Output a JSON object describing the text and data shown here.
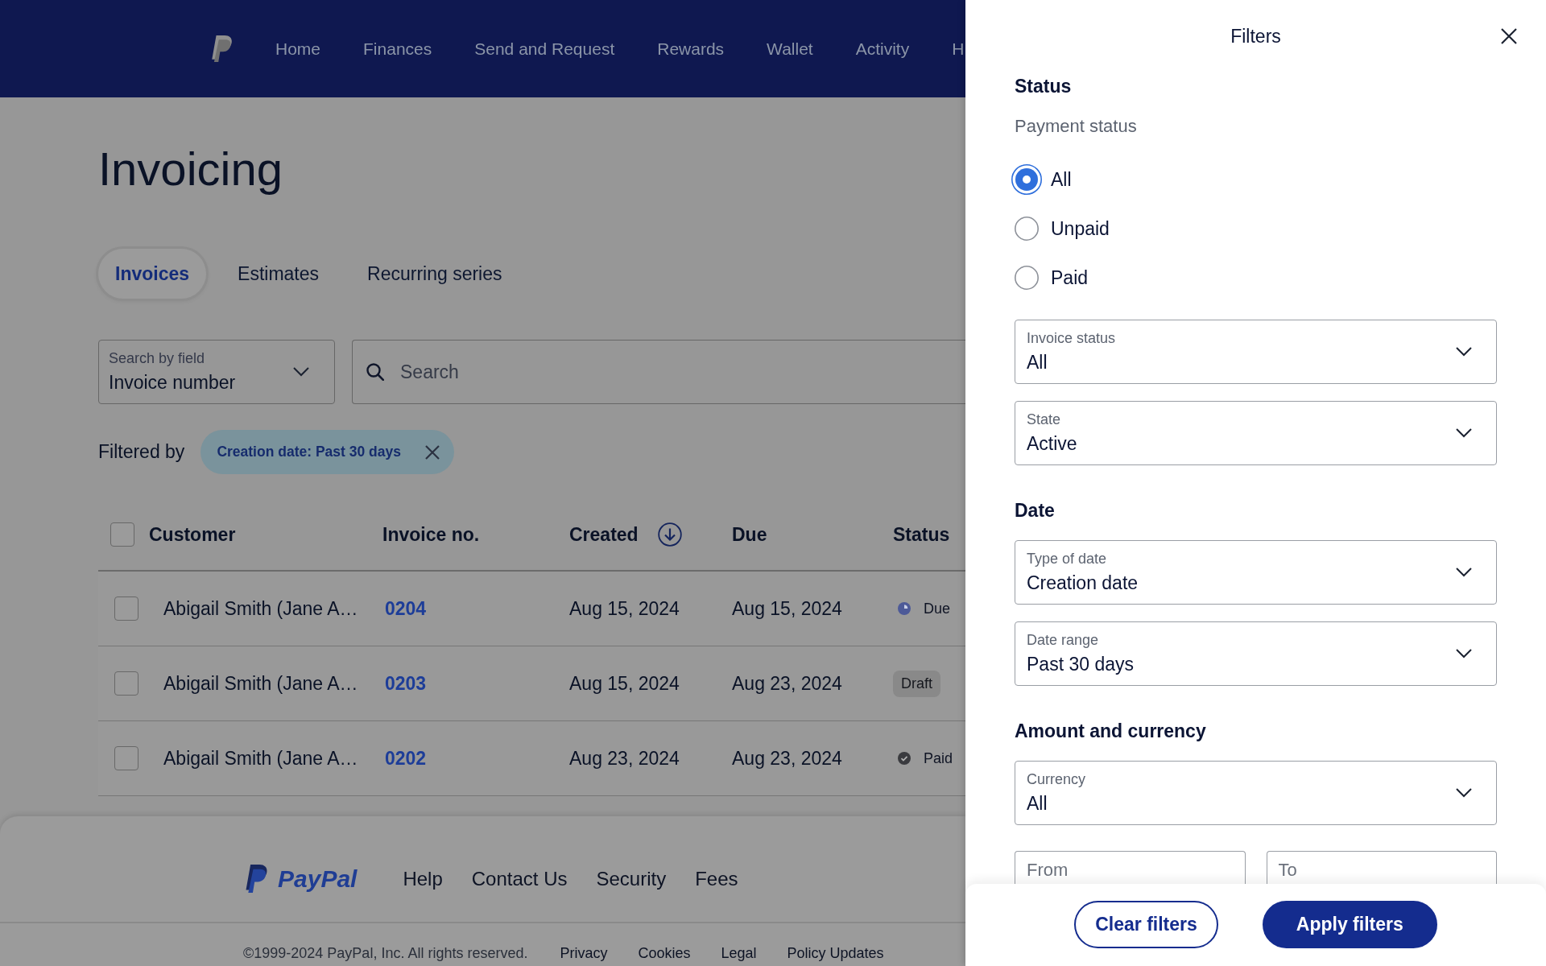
{
  "nav": {
    "items": [
      {
        "label": "Home"
      },
      {
        "label": "Finances"
      },
      {
        "label": "Send and Request"
      },
      {
        "label": "Rewards"
      },
      {
        "label": "Wallet"
      },
      {
        "label": "Activity"
      },
      {
        "label": "H"
      }
    ]
  },
  "page": {
    "title": "Invoicing"
  },
  "tabs": [
    {
      "label": "Invoices",
      "selected": true
    },
    {
      "label": "Estimates",
      "selected": false
    },
    {
      "label": "Recurring series",
      "selected": false
    }
  ],
  "search_by_field": {
    "label": "Search by field",
    "value": "Invoice number"
  },
  "search": {
    "placeholder": "Search"
  },
  "filtered_by": {
    "label": "Filtered by",
    "chips": [
      {
        "label": "Creation date: Past 30 days"
      }
    ]
  },
  "table": {
    "select_all": {
      "checked": false
    },
    "columns": [
      {
        "label": "Customer",
        "sorted": false
      },
      {
        "label": "Invoice no.",
        "sorted": false
      },
      {
        "label": "Created",
        "sorted": true
      },
      {
        "label": "Due",
        "sorted": false
      },
      {
        "label": "Status",
        "sorted": false
      }
    ],
    "rows": [
      {
        "checked": false,
        "customer": "Abigail Smith (Jane A…",
        "invoice_no": "0204",
        "created": "Aug 15, 2024",
        "due": "Aug 15, 2024",
        "status": {
          "kind": "due",
          "label": "Due"
        }
      },
      {
        "checked": false,
        "customer": "Abigail Smith (Jane A…",
        "invoice_no": "0203",
        "created": "Aug 15, 2024",
        "due": "Aug 23, 2024",
        "status": {
          "kind": "draft",
          "label": "Draft"
        }
      },
      {
        "checked": false,
        "customer": "Abigail Smith (Jane A…",
        "invoice_no": "0202",
        "created": "Aug 23, 2024",
        "due": "Aug 23, 2024",
        "status": {
          "kind": "paid",
          "label": "Paid"
        }
      }
    ]
  },
  "footer": {
    "brand": "PayPal",
    "links": [
      "Help",
      "Contact Us",
      "Security",
      "Fees"
    ],
    "copyright": "©1999-2024 PayPal, Inc. All rights reserved.",
    "legal_links": [
      "Privacy",
      "Cookies",
      "Legal",
      "Policy Updates"
    ]
  },
  "filters_panel": {
    "title": "Filters",
    "sections": [
      {
        "heading": "Status",
        "groups": [
          {
            "kind": "radio",
            "label": "Payment status",
            "options": [
              {
                "label": "All",
                "selected": true
              },
              {
                "label": "Unpaid",
                "selected": false
              },
              {
                "label": "Paid",
                "selected": false
              }
            ]
          },
          {
            "kind": "select",
            "label": "Invoice status",
            "value": "All"
          },
          {
            "kind": "select",
            "label": "State",
            "value": "Active"
          }
        ]
      },
      {
        "heading": "Date",
        "groups": [
          {
            "kind": "select",
            "label": "Type of date",
            "value": "Creation date"
          },
          {
            "kind": "select",
            "label": "Date range",
            "value": "Past 30 days"
          }
        ]
      },
      {
        "heading": "Amount and currency",
        "groups": [
          {
            "kind": "select",
            "label": "Currency",
            "value": "All"
          },
          {
            "kind": "range",
            "fields": [
              {
                "placeholder": "From"
              },
              {
                "placeholder": "To"
              }
            ]
          }
        ]
      }
    ],
    "buttons": [
      {
        "label": "Clear filters",
        "kind": "secondary"
      },
      {
        "label": "Apply filters",
        "kind": "primary"
      }
    ]
  }
}
